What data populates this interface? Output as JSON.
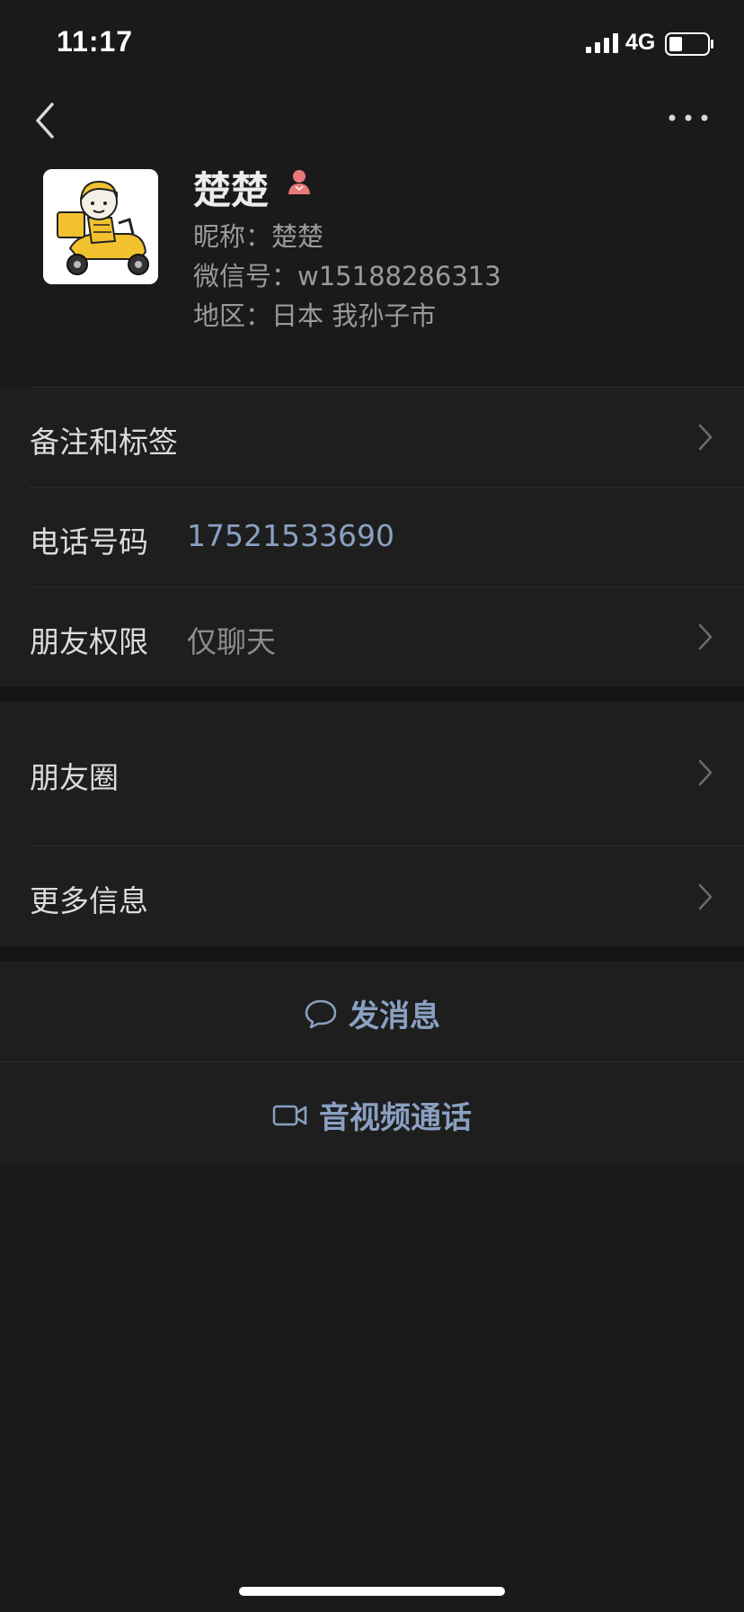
{
  "status_bar": {
    "time": "11:17",
    "network": "4G",
    "battery_level": 0.35
  },
  "profile": {
    "name": "楚楚",
    "nickname_line": "昵称：楚楚",
    "wechat_id_line": "微信号：w15188286313",
    "region_line": "地区：日本 我孙子市",
    "gender": "female",
    "gender_color": "#e8787a"
  },
  "rows": {
    "remarks": {
      "label": "备注和标签"
    },
    "phone": {
      "label": "电话号码",
      "value": "17521533690",
      "value_color": "#8aa0c2"
    },
    "permissions": {
      "label": "朋友权限",
      "value": "仅聊天"
    },
    "moments": {
      "label": "朋友圈"
    },
    "more_info": {
      "label": "更多信息"
    }
  },
  "actions": {
    "send_message": {
      "label": "发消息",
      "icon": "chat-bubble-icon"
    },
    "video_call": {
      "label": "音视频通话",
      "icon": "video-camera-icon"
    }
  },
  "colors": {
    "background": "#1a1a1a",
    "row_background": "#1e1e1e",
    "accent_link": "#8aa0c2"
  }
}
